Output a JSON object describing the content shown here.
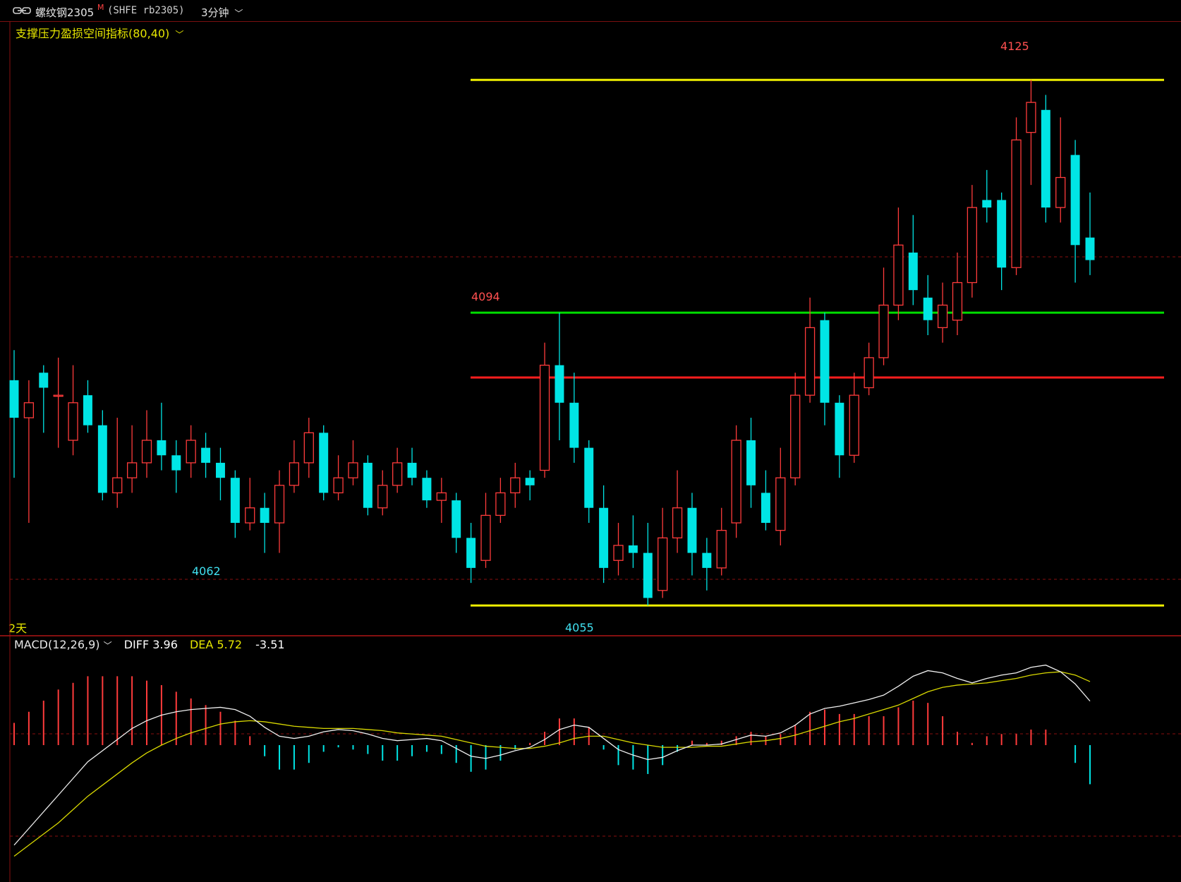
{
  "header": {
    "symbol_name": "螺纹钢2305",
    "symbol_mark": "M",
    "exchange_code": "(SHFE rb2305)",
    "period": "3分钟"
  },
  "indicator": {
    "name": "支撑压力盈损空间指标(80,40)",
    "range_label": "2天",
    "lines": {
      "upper_yellow": 4125,
      "green": 4094,
      "lower_yellow": 4055
    }
  },
  "price_labels": {
    "high_label": "4125",
    "mid_label": "4094",
    "low_label_1": "4062",
    "low_label_2": "4055"
  },
  "macd": {
    "title": "MACD(12,26,9)",
    "diff_label": "DIFF 3.96",
    "dea_label": "DEA 5.72",
    "macd_value": "-3.51"
  },
  "colors": {
    "up": "#ff3b3b",
    "down": "#00e5e5",
    "yellow": "#f0f000",
    "green": "#00dd00",
    "red_line": "#ff1e1e",
    "grid": "#8a0f0f"
  },
  "chart_data": [
    {
      "type": "candlestick",
      "title": "",
      "price_levels": [
        4125,
        4094,
        4055
      ],
      "candles": [
        [
          4085,
          4080,
          4089,
          4072
        ],
        [
          4080,
          4082,
          4085,
          4066
        ],
        [
          4086,
          4084,
          4087,
          4078
        ],
        [
          4083,
          4083,
          4088,
          4076
        ],
        [
          4077,
          4082,
          4087,
          4075
        ],
        [
          4083,
          4079,
          4085,
          4078
        ],
        [
          4079,
          4070,
          4081,
          4069
        ],
        [
          4070,
          4072,
          4080,
          4068
        ],
        [
          4072,
          4074,
          4079,
          4070
        ],
        [
          4074,
          4077,
          4081,
          4072
        ],
        [
          4077,
          4075,
          4082,
          4073
        ],
        [
          4075,
          4073,
          4077,
          4070
        ],
        [
          4074,
          4077,
          4079,
          4072
        ],
        [
          4076,
          4074,
          4078,
          4072
        ],
        [
          4074,
          4072,
          4076,
          4069
        ],
        [
          4072,
          4066,
          4073,
          4064
        ],
        [
          4066,
          4068,
          4072,
          4065
        ],
        [
          4068,
          4066,
          4070,
          4062
        ],
        [
          4066,
          4071,
          4073,
          4062
        ],
        [
          4071,
          4074,
          4077,
          4070
        ],
        [
          4074,
          4078,
          4080,
          4072
        ],
        [
          4078,
          4070,
          4079,
          4069
        ],
        [
          4070,
          4072,
          4075,
          4069
        ],
        [
          4072,
          4074,
          4077,
          4071
        ],
        [
          4074,
          4068,
          4075,
          4067
        ],
        [
          4068,
          4071,
          4073,
          4067
        ],
        [
          4071,
          4074,
          4076,
          4070
        ],
        [
          4074,
          4072,
          4076,
          4071
        ],
        [
          4072,
          4069,
          4073,
          4068
        ],
        [
          4069,
          4070,
          4072,
          4066
        ],
        [
          4069,
          4064,
          4070,
          4062
        ],
        [
          4064,
          4060,
          4066,
          4058
        ],
        [
          4061,
          4067,
          4070,
          4060
        ],
        [
          4067,
          4070,
          4072,
          4066
        ],
        [
          4070,
          4072,
          4074,
          4068
        ],
        [
          4072,
          4071,
          4073,
          4069
        ],
        [
          4073,
          4087,
          4090,
          4072
        ],
        [
          4087,
          4082,
          4094,
          4077
        ],
        [
          4082,
          4076,
          4086,
          4074
        ],
        [
          4076,
          4068,
          4077,
          4066
        ],
        [
          4068,
          4060,
          4071,
          4058
        ],
        [
          4061,
          4063,
          4066,
          4059
        ],
        [
          4063,
          4062,
          4067,
          4060
        ],
        [
          4062,
          4056,
          4066,
          4055
        ],
        [
          4057,
          4064,
          4068,
          4056
        ],
        [
          4064,
          4068,
          4073,
          4062
        ],
        [
          4068,
          4062,
          4070,
          4059
        ],
        [
          4062,
          4060,
          4064,
          4057
        ],
        [
          4060,
          4065,
          4068,
          4059
        ],
        [
          4066,
          4077,
          4079,
          4064
        ],
        [
          4077,
          4071,
          4080,
          4068
        ],
        [
          4070,
          4066,
          4073,
          4065
        ],
        [
          4065,
          4072,
          4076,
          4063
        ],
        [
          4072,
          4083,
          4086,
          4071
        ],
        [
          4083,
          4092,
          4096,
          4082
        ],
        [
          4093,
          4082,
          4094,
          4079
        ],
        [
          4082,
          4075,
          4083,
          4072
        ],
        [
          4075,
          4083,
          4086,
          4074
        ],
        [
          4084,
          4088,
          4090,
          4083
        ],
        [
          4088,
          4095,
          4100,
          4087
        ],
        [
          4095,
          4103,
          4108,
          4093
        ],
        [
          4102,
          4097,
          4107,
          4095
        ],
        [
          4096,
          4093,
          4099,
          4091
        ],
        [
          4092,
          4095,
          4098,
          4090
        ],
        [
          4093,
          4098,
          4102,
          4091
        ],
        [
          4098,
          4108,
          4111,
          4096
        ],
        [
          4109,
          4108,
          4113,
          4106
        ],
        [
          4109,
          4100,
          4110,
          4097
        ],
        [
          4100,
          4117,
          4120,
          4099
        ],
        [
          4118,
          4122,
          4125,
          4111
        ],
        [
          4121,
          4108,
          4123,
          4106
        ],
        [
          4108,
          4112,
          4120,
          4106
        ],
        [
          4115,
          4103,
          4117,
          4098
        ],
        [
          4104,
          4101,
          4110,
          4099
        ]
      ],
      "ylim": [
        4052,
        4130
      ]
    },
    {
      "type": "macd",
      "title": "MACD(12,26,9)",
      "series": [
        {
          "name": "DIFF",
          "values": [
            -9,
            -7.5,
            -6,
            -4.5,
            -3,
            -1.5,
            -0.5,
            0.5,
            1.5,
            2.2,
            2.7,
            3.0,
            3.2,
            3.3,
            3.4,
            3.2,
            2.6,
            1.6,
            0.8,
            0.6,
            0.8,
            1.2,
            1.4,
            1.3,
            1.0,
            0.6,
            0.4,
            0.5,
            0.6,
            0.4,
            -0.3,
            -1.0,
            -1.2,
            -0.9,
            -0.5,
            -0.2,
            0.5,
            1.4,
            1.8,
            1.6,
            0.6,
            -0.4,
            -0.9,
            -1.3,
            -1.1,
            -0.5,
            0.0,
            0.0,
            0.1,
            0.5,
            0.9,
            0.8,
            1.1,
            1.8,
            2.8,
            3.3,
            3.5,
            3.8,
            4.1,
            4.5,
            5.3,
            6.2,
            6.7,
            6.5,
            6.0,
            5.6,
            6.0,
            6.3,
            6.5,
            7.0,
            7.2,
            6.6,
            5.5,
            3.96
          ]
        },
        {
          "name": "DEA",
          "values": [
            -10,
            -9,
            -8,
            -7,
            -5.8,
            -4.6,
            -3.6,
            -2.6,
            -1.6,
            -0.7,
            0.0,
            0.6,
            1.1,
            1.5,
            1.9,
            2.1,
            2.2,
            2.1,
            1.9,
            1.7,
            1.6,
            1.5,
            1.5,
            1.5,
            1.4,
            1.3,
            1.1,
            1.0,
            0.9,
            0.8,
            0.5,
            0.2,
            -0.1,
            -0.2,
            -0.3,
            -0.3,
            -0.1,
            0.2,
            0.6,
            0.8,
            0.8,
            0.5,
            0.2,
            0.0,
            -0.2,
            -0.2,
            -0.2,
            -0.1,
            -0.1,
            0.1,
            0.3,
            0.4,
            0.6,
            0.9,
            1.3,
            1.7,
            2.1,
            2.4,
            2.8,
            3.2,
            3.6,
            4.2,
            4.8,
            5.2,
            5.4,
            5.5,
            5.6,
            5.8,
            6.0,
            6.3,
            6.5,
            6.6,
            6.3,
            5.72
          ]
        }
      ],
      "ylim": [
        -12,
        8
      ]
    }
  ]
}
